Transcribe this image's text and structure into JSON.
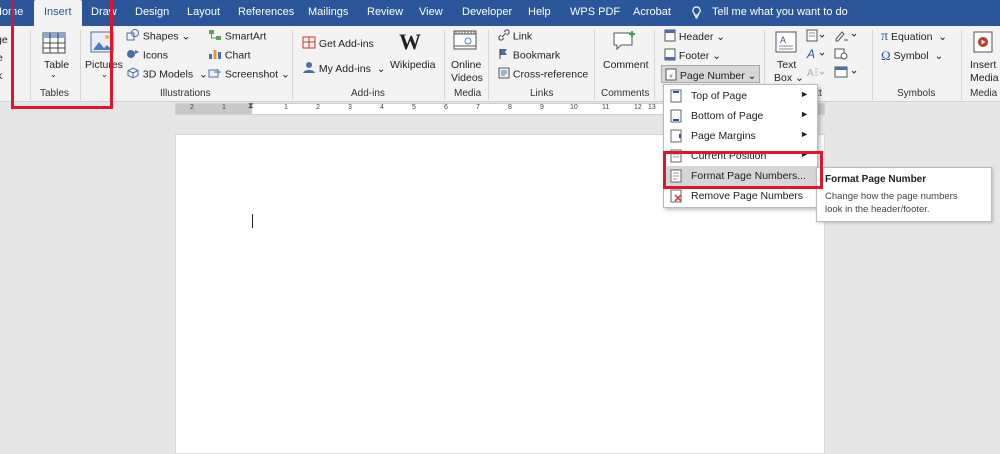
{
  "tabs": [
    "Home",
    "Insert",
    "Draw",
    "Design",
    "Layout",
    "References",
    "Mailings",
    "Review",
    "View",
    "Developer",
    "Help",
    "WPS PDF",
    "Acrobat"
  ],
  "tell_me": "Tell me what you want to do",
  "groups": {
    "tables": {
      "button": "Table",
      "label": "Tables"
    },
    "illustrations": {
      "pictures": "Pictures",
      "shapes": "Shapes",
      "icons": "Icons",
      "models": "3D Models",
      "smartart": "SmartArt",
      "chart": "Chart",
      "screenshot": "Screenshot",
      "label": "Illustrations"
    },
    "addins": {
      "get": "Get Add-ins",
      "my": "My Add-ins",
      "wikipedia": "Wikipedia",
      "label": "Add-ins"
    },
    "media": {
      "video_line1": "Online",
      "video_line2": "Videos",
      "label": "Media"
    },
    "links": {
      "link": "Link",
      "bookmark": "Bookmark",
      "crossref": "Cross-reference",
      "label": "Links"
    },
    "comments": {
      "comment": "Comment",
      "label": "Comments"
    },
    "header_footer": {
      "header": "Header",
      "footer": "Footer",
      "page_number": "Page Number"
    },
    "text": {
      "textbox_line1": "Text",
      "textbox_line2": "Box",
      "label_fragment": "xt"
    },
    "symbols": {
      "equation": "Equation",
      "symbol": "Symbol",
      "label": "Symbols"
    },
    "media2": {
      "line1": "Insert",
      "line2": "Media",
      "label": "Media"
    }
  },
  "ruler_numbers": [
    "2",
    "1",
    "1",
    "2",
    "3",
    "4",
    "5",
    "6",
    "7",
    "8",
    "9",
    "10",
    "11",
    "12",
    "13"
  ],
  "menu": {
    "items": [
      {
        "label": "Top of Page",
        "submenu": true
      },
      {
        "label": "Bottom of Page",
        "submenu": true
      },
      {
        "label": "Page Margins",
        "submenu": true
      },
      {
        "label": "Current Position",
        "submenu": true
      },
      {
        "label": "Format Page Numbers...",
        "submenu": false
      },
      {
        "label": "Remove Page Numbers",
        "submenu": false
      }
    ]
  },
  "tooltip": {
    "title": "Format Page Number",
    "body_line1": "Change how the page numbers",
    "body_line2": "look in the header/footer."
  },
  "colors": {
    "accent": "#2b579a",
    "highlight": "#e0142a"
  }
}
